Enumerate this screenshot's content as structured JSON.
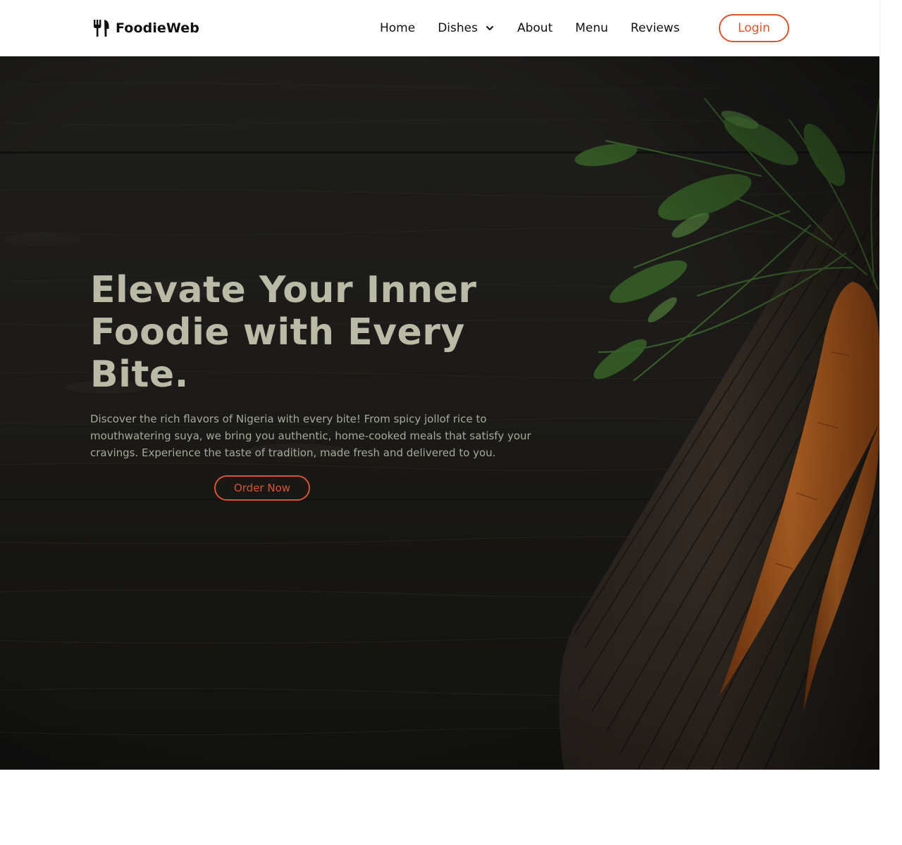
{
  "brand": {
    "name": "FoodieWeb",
    "icon": "fork-knife-icon"
  },
  "nav": {
    "items": [
      {
        "label": "Home"
      },
      {
        "label": "Dishes",
        "icon": "chevron-down-icon"
      },
      {
        "label": "About"
      },
      {
        "label": "Menu"
      },
      {
        "label": "Reviews"
      }
    ],
    "login_label": "Login"
  },
  "hero": {
    "title": "Elevate Your Inner Foodie with Every Bite.",
    "description": "Discover the rich flavors of Nigeria with every bite! From spicy jollof rice to mouthwatering suya, we bring you authentic, home-cooked meals that satisfy your cravings. Experience the taste of tradition, made fresh and delivered to you.",
    "cta_label": "Order Now"
  },
  "colors": {
    "accent": "#d9542e",
    "hero_text": "#b9bba6",
    "hero_background": "#1d1c1a",
    "nav_background": "#ffffff"
  }
}
